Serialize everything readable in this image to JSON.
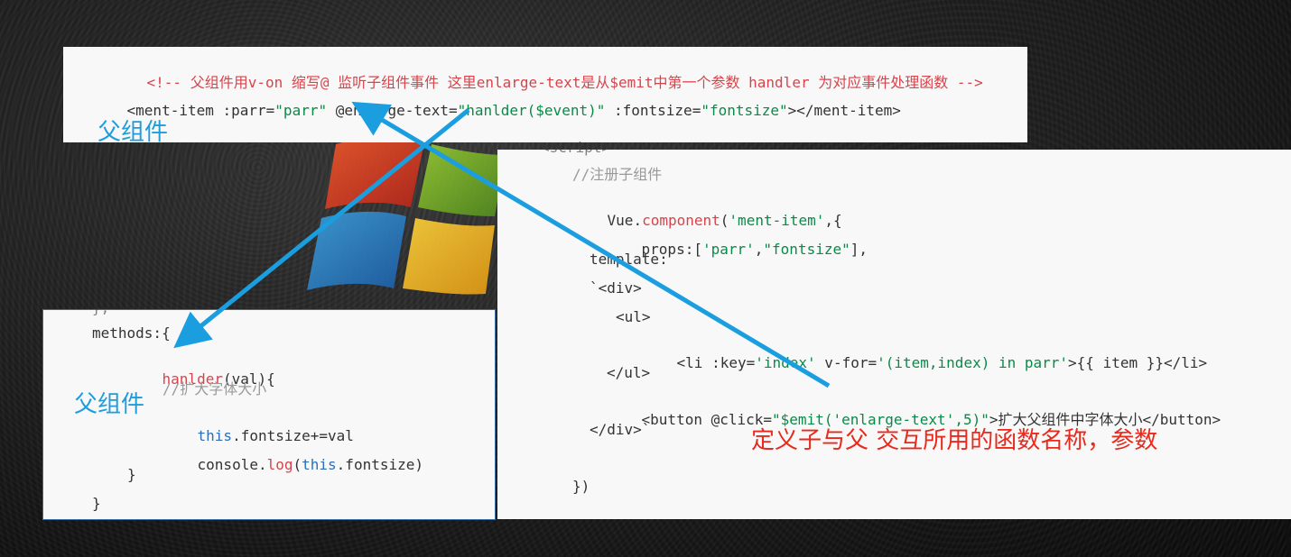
{
  "top_panel": {
    "comment_line": "<!-- 父组件用v-on 缩写@ 监听子组件事件 这里enlarge-text是从$emit中第一个参数 handler 为对应事件处理函数 -->",
    "tag_parts": [
      "<ment-item ",
      ":parr=",
      "\"parr\"",
      " @enlarge-text=",
      "\"hanlder($event)\"",
      " :fontsize=",
      "\"fontsize\"",
      "></ment-item>"
    ],
    "label": "父组件"
  },
  "right_panel": {
    "partial_top": "<script>",
    "comment": "//注册子组件",
    "l_vue": "Vue",
    "l_dot": ".",
    "l_component": "component",
    "l_args": "(",
    "l_name": "'ment-item'",
    "l_after": ",{",
    "l_props_key": "props",
    "l_props_colon": ":[",
    "l_props_a": "'parr'",
    "l_props_comma": ",",
    "l_props_b": "\"fontsize\"",
    "l_props_end": "],",
    "l_template": "template:",
    "l_div_open": "`<div>",
    "l_ul_open": "<ul>",
    "l_li_a": "<li ",
    "l_li_key": ":key=",
    "l_li_keyval": "'index'",
    "l_li_vfor": " v-for=",
    "l_li_vforval": "'(item,index) in parr'",
    "l_li_body": ">{{ item }}</li>",
    "l_ul_close": "</ul>",
    "l_btn_a": "<button @click=",
    "l_btn_val": "\"$emit('enlarge-text',5)\"",
    "l_btn_body": ">扩大父组件中字体大小</button>",
    "l_div_close": "</div>`",
    "l_end": "})",
    "annotation": "定义子与父 交互所用的函数名称，参数"
  },
  "left_panel": {
    "l_partial": "},",
    "l_methods": "methods:{",
    "l_fn_name": "hanlder",
    "l_fn_args": "(val){",
    "l_comment": "//扩大字体大小",
    "l_this1": "this",
    "l_fs1": ".fontsize+=val",
    "l_console": "console.",
    "l_log": "log",
    "l_log_open": "(",
    "l_this2": "this",
    "l_log_rest": ".fontsize)",
    "l_close1": "}",
    "l_close2": "}",
    "label": "父组件"
  },
  "colors": {
    "arrow": "#1a9ee0",
    "string": "#0a8a48",
    "keyword": "#d7444b",
    "comment": "#999999",
    "annotation_red": "#e8291c",
    "label_blue": "#1e9ddb"
  }
}
